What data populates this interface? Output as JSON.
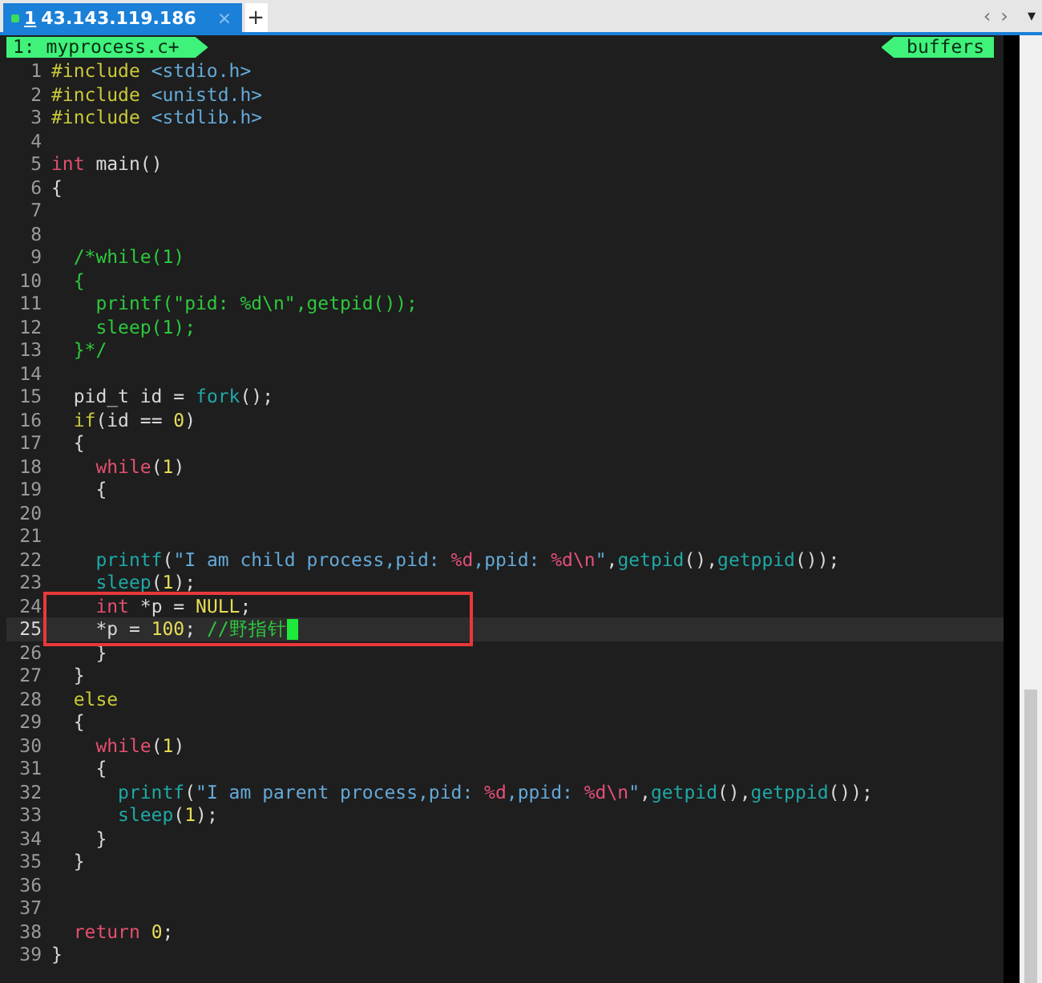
{
  "tabs": [
    {
      "number": "1",
      "label": "43.143.119.186",
      "close": "×",
      "selected": true
    }
  ],
  "new_tab": "+",
  "tab_nav": {
    "prev": "‹",
    "next": "›",
    "menu": "▾"
  },
  "editor": {
    "file_label": "1: myprocess.c+",
    "buffers_label": "buffers",
    "lines": [
      {
        "number": "1",
        "current": false,
        "segments": [
          {
            "kind": "pre",
            "text": "#include"
          },
          {
            "kind": "str",
            "text": " <stdio.h>"
          }
        ]
      },
      {
        "number": "2",
        "current": false,
        "segments": [
          {
            "kind": "pre",
            "text": "#include"
          },
          {
            "kind": "str",
            "text": " <unistd.h>"
          }
        ]
      },
      {
        "number": "3",
        "current": false,
        "segments": [
          {
            "kind": "pre",
            "text": "#include"
          },
          {
            "kind": "str",
            "text": " <stdlib.h>"
          }
        ]
      },
      {
        "number": "4",
        "current": false
      },
      {
        "number": "5",
        "current": false,
        "segments": [
          {
            "kind": "kw",
            "text": "int"
          },
          {
            "kind": "plain",
            "text": " main()"
          }
        ]
      },
      {
        "number": "6",
        "current": false,
        "segments": [
          {
            "kind": "plain",
            "text": "{"
          }
        ]
      },
      {
        "number": "7",
        "current": false
      },
      {
        "number": "8",
        "current": false
      },
      {
        "number": "9",
        "current": false,
        "segments": [
          {
            "kind": "cmt",
            "text": "  /*while(1)"
          }
        ]
      },
      {
        "number": "10",
        "current": false,
        "segments": [
          {
            "kind": "cmt",
            "text": "  {"
          }
        ]
      },
      {
        "number": "11",
        "current": false,
        "segments": [
          {
            "kind": "cmt",
            "text": "    printf(\"pid: %d\\n\",getpid());"
          }
        ]
      },
      {
        "number": "12",
        "current": false,
        "segments": [
          {
            "kind": "cmt",
            "text": "    sleep(1);"
          }
        ]
      },
      {
        "number": "13",
        "current": false,
        "segments": [
          {
            "kind": "cmt",
            "text": "  }*/"
          }
        ]
      },
      {
        "number": "14",
        "current": false
      },
      {
        "number": "15",
        "current": false,
        "segments": [
          {
            "kind": "plain",
            "text": "  pid_t id = "
          },
          {
            "kind": "fn",
            "text": "fork"
          },
          {
            "kind": "plain",
            "text": "();"
          }
        ]
      },
      {
        "number": "16",
        "current": false,
        "segments": [
          {
            "kind": "cond",
            "text": "  if"
          },
          {
            "kind": "plain",
            "text": "(id == "
          },
          {
            "kind": "num",
            "text": "0"
          },
          {
            "kind": "plain",
            "text": ")"
          }
        ]
      },
      {
        "number": "17",
        "current": false,
        "segments": [
          {
            "kind": "plain",
            "text": "  {"
          }
        ]
      },
      {
        "number": "18",
        "current": false,
        "segments": [
          {
            "kind": "kw",
            "text": "    while"
          },
          {
            "kind": "plain",
            "text": "("
          },
          {
            "kind": "num",
            "text": "1"
          },
          {
            "kind": "plain",
            "text": ")"
          }
        ]
      },
      {
        "number": "19",
        "current": false,
        "segments": [
          {
            "kind": "plain",
            "text": "    {"
          }
        ]
      },
      {
        "number": "20",
        "current": false
      },
      {
        "number": "21",
        "current": false
      },
      {
        "number": "22",
        "current": false,
        "segments": [
          {
            "kind": "fn",
            "text": "    printf"
          },
          {
            "kind": "plain",
            "text": "("
          },
          {
            "kind": "str",
            "text": "\"I am child process,pid: "
          },
          {
            "kind": "fmt",
            "text": "%d"
          },
          {
            "kind": "str",
            "text": ",ppid: "
          },
          {
            "kind": "fmt",
            "text": "%d\\n"
          },
          {
            "kind": "str",
            "text": "\""
          },
          {
            "kind": "plain",
            "text": ","
          },
          {
            "kind": "fn",
            "text": "getpid"
          },
          {
            "kind": "plain",
            "text": "(),"
          },
          {
            "kind": "fn",
            "text": "getppid"
          },
          {
            "kind": "plain",
            "text": "());"
          }
        ]
      },
      {
        "number": "23",
        "current": false,
        "segments": [
          {
            "kind": "fn",
            "text": "    sleep"
          },
          {
            "kind": "plain",
            "text": "("
          },
          {
            "kind": "num",
            "text": "1"
          },
          {
            "kind": "plain",
            "text": ");"
          }
        ]
      },
      {
        "number": "24",
        "current": false,
        "segments": [
          {
            "kind": "kw",
            "text": "    int"
          },
          {
            "kind": "plain",
            "text": " *p = "
          },
          {
            "kind": "num",
            "text": "NULL"
          },
          {
            "kind": "plain",
            "text": ";"
          }
        ]
      },
      {
        "number": "25",
        "current": true,
        "segments": [
          {
            "kind": "plain",
            "text": "    *p = "
          },
          {
            "kind": "num",
            "text": "100"
          },
          {
            "kind": "plain",
            "text": "; "
          },
          {
            "kind": "cmt",
            "text": "//野指针"
          }
        ]
      },
      {
        "number": "26",
        "current": false,
        "segments": [
          {
            "kind": "plain",
            "text": "    }"
          }
        ]
      },
      {
        "number": "27",
        "current": false,
        "segments": [
          {
            "kind": "plain",
            "text": "  }"
          }
        ]
      },
      {
        "number": "28",
        "current": false,
        "segments": [
          {
            "kind": "cond",
            "text": "  else"
          }
        ]
      },
      {
        "number": "29",
        "current": false,
        "segments": [
          {
            "kind": "plain",
            "text": "  {"
          }
        ]
      },
      {
        "number": "30",
        "current": false,
        "segments": [
          {
            "kind": "kw",
            "text": "    while"
          },
          {
            "kind": "plain",
            "text": "("
          },
          {
            "kind": "num",
            "text": "1"
          },
          {
            "kind": "plain",
            "text": ")"
          }
        ]
      },
      {
        "number": "31",
        "current": false,
        "segments": [
          {
            "kind": "plain",
            "text": "    {"
          }
        ]
      },
      {
        "number": "32",
        "current": false,
        "segments": [
          {
            "kind": "fn",
            "text": "      printf"
          },
          {
            "kind": "plain",
            "text": "("
          },
          {
            "kind": "str",
            "text": "\"I am parent process,pid: "
          },
          {
            "kind": "fmt",
            "text": "%d"
          },
          {
            "kind": "str",
            "text": ",ppid: "
          },
          {
            "kind": "fmt",
            "text": "%d\\n"
          },
          {
            "kind": "str",
            "text": "\""
          },
          {
            "kind": "plain",
            "text": ","
          },
          {
            "kind": "fn",
            "text": "getpid"
          },
          {
            "kind": "plain",
            "text": "(),"
          },
          {
            "kind": "fn",
            "text": "getppid"
          },
          {
            "kind": "plain",
            "text": "());"
          }
        ]
      },
      {
        "number": "33",
        "current": false,
        "segments": [
          {
            "kind": "fn",
            "text": "      sleep"
          },
          {
            "kind": "plain",
            "text": "("
          },
          {
            "kind": "num",
            "text": "1"
          },
          {
            "kind": "plain",
            "text": ");"
          }
        ]
      },
      {
        "number": "34",
        "current": false,
        "segments": [
          {
            "kind": "plain",
            "text": "    }"
          }
        ]
      },
      {
        "number": "35",
        "current": false,
        "segments": [
          {
            "kind": "plain",
            "text": "  }"
          }
        ]
      },
      {
        "number": "36",
        "current": false
      },
      {
        "number": "37",
        "current": false
      },
      {
        "number": "38",
        "current": false,
        "segments": [
          {
            "kind": "kw",
            "text": "  return"
          },
          {
            "kind": "num",
            "text": " 0"
          },
          {
            "kind": "plain",
            "text": ";"
          }
        ]
      },
      {
        "number": "39",
        "current": false,
        "segments": [
          {
            "kind": "plain",
            "text": "}"
          }
        ]
      }
    ]
  }
}
